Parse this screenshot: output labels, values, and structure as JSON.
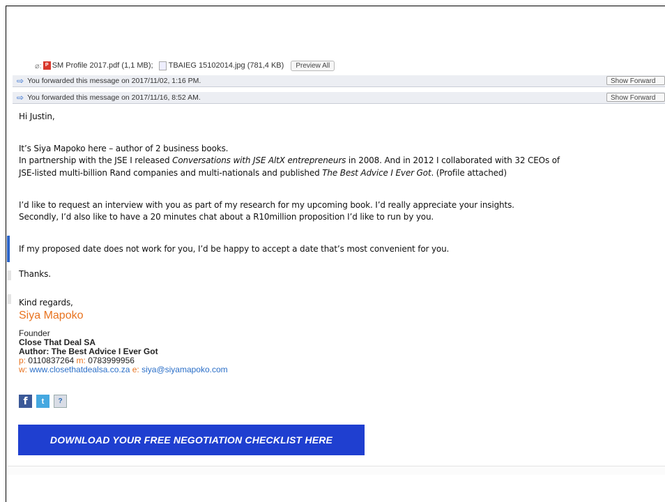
{
  "attachments": {
    "file1": "SM Profile 2017.pdf (1,1 MB);",
    "file2": "TBAIEG 15102014.jpg (781,4 KB)",
    "preview_all": "Preview All"
  },
  "forward_notices": [
    {
      "text": "You forwarded this message on 2017/11/02, 1:16 PM.",
      "button": "Show Forward"
    },
    {
      "text": "You forwarded this message on 2017/11/16, 8:52 AM.",
      "button": "Show Forward"
    }
  ],
  "email": {
    "greeting": "Hi Justin,",
    "intro": "It’s Siya Mapoko here – author of 2 business books.",
    "p1_a": "In partnership with the JSE I released ",
    "p1_i": "Conversations with JSE AltX entrepreneurs",
    "p1_b": " in 2008. And in 2012 I collaborated with 32 CEOs of",
    "p2_a": "JSE-listed multi-billion Rand companies and multi-nationals and published ",
    "p2_i": "The Best Advice I Ever Got",
    "p2_b": ". (Profile attached)",
    "p3": "I’d like to request an interview with you as part of my research for my upcoming book. I’d really appreciate your insights.",
    "p4": "Secondly, I’d also like to have a 20 minutes chat about a R10million proposition I’d like to run by you.",
    "p5": "If my proposed date does not work for you, I’d be happy to accept a date that’s most convenient for you.",
    "thanks": "Thanks.",
    "regards": "Kind regards,"
  },
  "signature": {
    "name": "Siya Mapoko",
    "title": "Founder",
    "company_bold": "Close",
    "company_rest": " That Deal SA",
    "author": "Author: The Best Advice I Ever Got",
    "p_label": "p:",
    "phone": " 0110837264 ",
    "m_label": "m:",
    "mobile": " 0783999956",
    "w_label": "w:",
    "website": " www.closethatdealsa.co.za ",
    "e_label": "e:",
    "email": " siya@siyamapoko.com",
    "social": [
      "facebook-icon",
      "twitter-icon",
      "linkedin-icon"
    ],
    "cta": "DOWNLOAD YOUR FREE NEGOTIATION CHECKLIST HERE"
  }
}
